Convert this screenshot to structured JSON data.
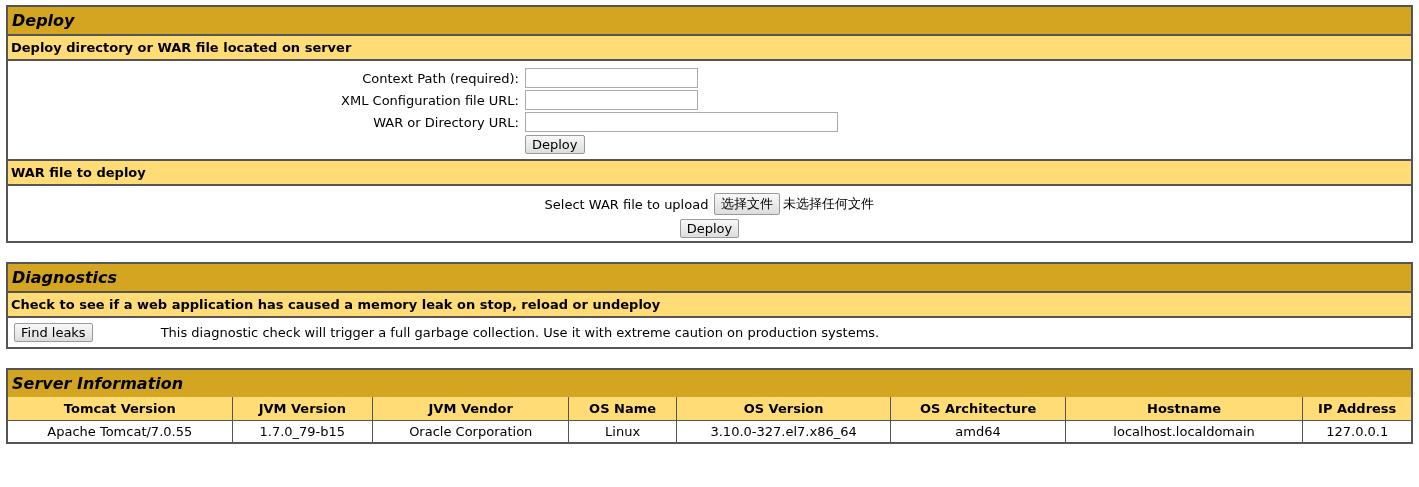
{
  "deploy": {
    "title": "Deploy",
    "server_section": {
      "heading": "Deploy directory or WAR file located on server",
      "fields": [
        {
          "label": "Context Path (required):",
          "kind": "short"
        },
        {
          "label": "XML Configuration file URL:",
          "kind": "short"
        },
        {
          "label": "WAR or Directory URL:",
          "kind": "long"
        }
      ],
      "button": "Deploy"
    },
    "upload_section": {
      "heading": "WAR file to deploy",
      "label": "Select WAR file to upload",
      "choose_button": "选择文件",
      "file_status": "未选择任何文件",
      "button": "Deploy"
    }
  },
  "diagnostics": {
    "title": "Diagnostics",
    "heading": "Check to see if a web application has caused a memory leak on stop, reload or undeploy",
    "button": "Find leaks",
    "note": "This diagnostic check will trigger a full garbage collection. Use it with extreme caution on production systems."
  },
  "server_info": {
    "title": "Server Information",
    "columns": [
      "Tomcat Version",
      "JVM Version",
      "JVM Vendor",
      "OS Name",
      "OS Version",
      "OS Architecture",
      "Hostname",
      "IP Address"
    ],
    "rows": [
      [
        "Apache Tomcat/7.0.55",
        "1.7.0_79-b15",
        "Oracle Corporation",
        "Linux",
        "3.10.0-327.el7.x86_64",
        "amd64",
        "localhost.localdomain",
        "127.0.0.1"
      ]
    ]
  }
}
